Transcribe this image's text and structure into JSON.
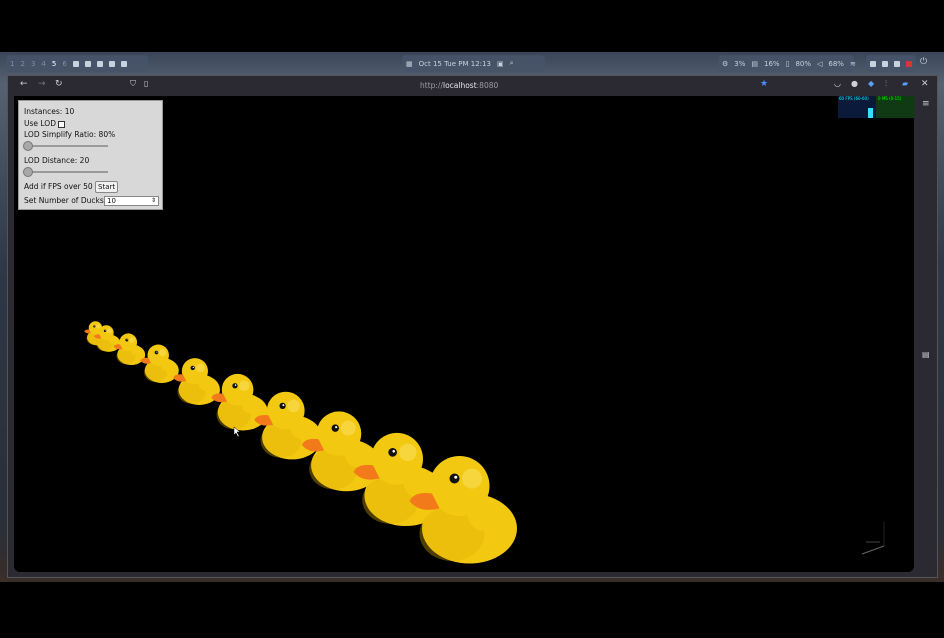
{
  "taskbar": {
    "workspaces": [
      "1",
      "2",
      "3",
      "4",
      "5",
      "6"
    ],
    "active_workspace": "5",
    "clock": "Oct 15 Tue   PM 12:13",
    "cpu": "3%",
    "memory": "16%",
    "disk": "80%",
    "volume": "68%"
  },
  "browser": {
    "url_prefix": "http://",
    "url_host": "localhost",
    "url_port": ":8080"
  },
  "controls": {
    "instances_label": "Instances: 10",
    "use_lod_label": "Use LOD",
    "lod_ratio_label": "LOD Simplify Ratio: 80%",
    "lod_distance_label": "LOD Distance: 20",
    "add_fps_label": "Add if FPS over 50",
    "start_button": "Start",
    "set_ducks_label": "Set Number of Ducks:",
    "ducks_value": "10"
  },
  "stats": {
    "fps_label": "60 FPS (60-60)",
    "ms_label": "0 MS (0-15)"
  },
  "scene": {
    "duck_count": 10,
    "duck_color": "#f2c811",
    "beak_color": "#f27a1a"
  }
}
